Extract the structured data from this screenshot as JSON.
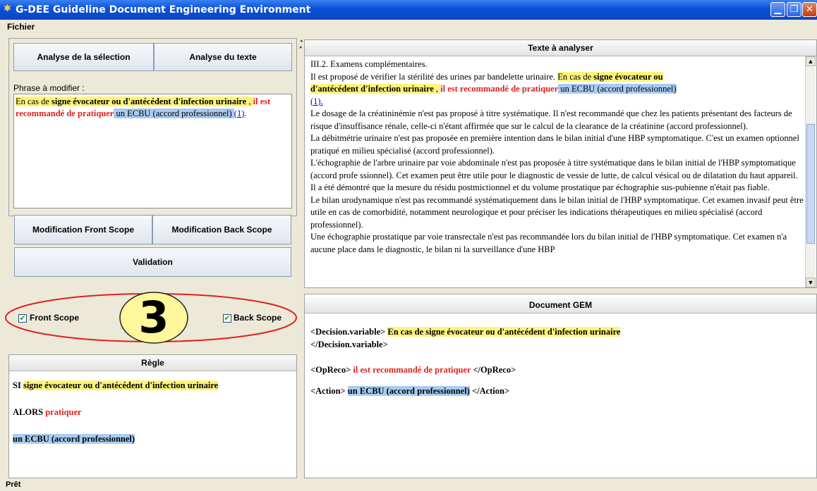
{
  "window": {
    "title": "G-DEE Guideline Document Engineering Environment"
  },
  "menu": {
    "items": [
      "Fichier"
    ]
  },
  "left": {
    "btn_analyse_selection": "Analyse de la sélection",
    "btn_analyse_texte": "Analyse du texte",
    "phrase_label": "Phrase à modifier :",
    "phrase": {
      "a": "En cas de ",
      "b": "signe évocateur ou d'antécédent d'infection urinaire",
      "c": " , ",
      "d": "il est recommandé de pratiquer",
      "e": " un ECBU (accord professionnel) ",
      "f": "(1)",
      "g": "."
    },
    "btn_front_scope": "Modification Front Scope",
    "btn_back_scope": "Modification Back Scope",
    "btn_validation": "Validation",
    "chk_front_scope": "Front Scope",
    "chk_back_scope": "Back Scope",
    "callout_number": "3",
    "regle_title": "Règle",
    "regle": {
      "si_kw": "SI ",
      "si_text": "signe évocateur ou d'antécédent d'infection urinaire",
      "alors_kw": "ALORS ",
      "alors_text": "pratiquer",
      "action": "un ECBU (accord professionnel)"
    }
  },
  "right": {
    "texte_title": "Texte à analyser",
    "texte": {
      "l1": "III.2. Examens complémentaires.",
      "l2a": "Il est proposé de vérifier la stérilité des urines par bandelette urinaire. ",
      "l2b": "En cas de ",
      "l2c": "signe évocateur ou",
      "l3a": "d'antécédent d'infection urinaire",
      "l3b": " , ",
      "l3c": "il est recommandé de pratiquer",
      "l3d": " un ECBU (accord professionnel)",
      "l4": "(1).",
      "p2": "Le dosage de la créatininémie n'est pas proposé à titre systématique. Il n'est recommandé que chez les patients présentant des facteurs de risque d'insuffisance rénale, celle-ci n'étant affirmée que sur le calcul de la clearance de la créatinine (accord professionnel).",
      "p3": "La débitmétrie urinaire n'est pas proposée en première intention dans le bilan initial d'une HBP symptomatique. C'est un examen optionnel pratiqué en milieu spécialisé (accord professionnel).",
      "p4": "L'échographie de l'arbre urinaire par voie abdominale n'est pas proposée à titre systématique dans le bilan initial de l'HBP symptomatique (accord profe ssionnel). Cet examen peut être utile pour le diagnostic de vessie de lutte, de calcul vésical ou de dilatation du haut appareil. Il a été démontré que la mesure du résidu postmictionnel et du volume prostatique par échographie sus-pubienne n'était pas fiable.",
      "p5": "Le bilan urodynamique n'est pas recommandé systématiquement dans le bilan initial de l'HBP symptomatique. Cet examen invasif peut être utile en cas de comorbidité, notamment neurologique et pour préciser les indications thérapeutiques en milieu spécialisé (accord professionnel).",
      "p6": "Une échographie prostatique par voie transrectale n'est pas recommandée lors du bilan initial de l'HBP symptomatique. Cet examen n'a aucune place dans le diagnostic, le bilan ni la surveillance d'une HBP"
    },
    "gem_title": "Document GEM",
    "gem": {
      "dv_open": "<Decision.variable> ",
      "dv_text": "En cas de signe évocateur ou d'antécédent d'infection urinaire",
      "dv_close": "</Decision.variable>",
      "op_open": "<OpReco> ",
      "op_text": "il est recommandé de pratiquer",
      "op_close": " </OpReco>",
      "ac_open": "<Action> ",
      "ac_text": "un ECBU (accord professionnel)",
      "ac_close": " </Action>"
    }
  },
  "status": {
    "text": "Prêt"
  },
  "colors": {
    "highlight_yellow": "#fff47a",
    "highlight_blue": "#a8ccf2",
    "keyword_red": "#e02020",
    "callout_ring": "#e02020",
    "callout_fill": "#fff79a"
  }
}
